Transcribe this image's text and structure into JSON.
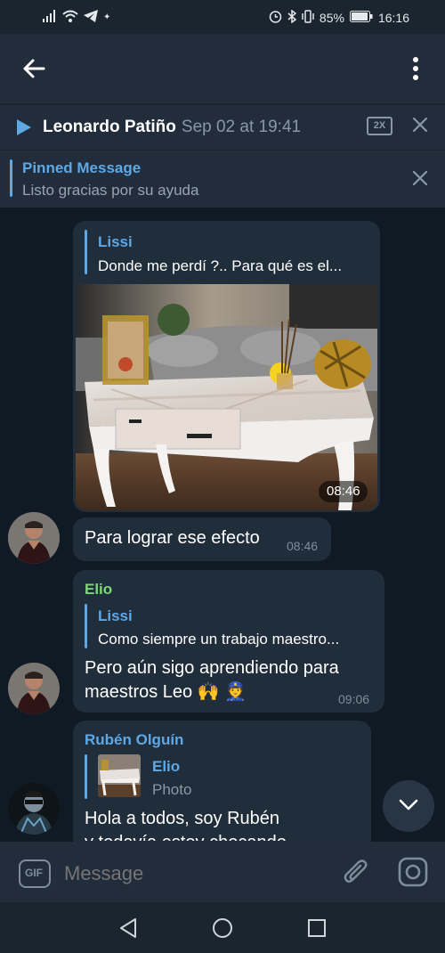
{
  "status_bar": {
    "battery_percent": "85%",
    "time": "16:16"
  },
  "player": {
    "name": "Leonardo Patiño",
    "date": "Sep 02 at 19:41",
    "speed": "2X"
  },
  "pinned": {
    "title": "Pinned Message",
    "text": "Listo gracias por su ayuda"
  },
  "messages": [
    {
      "reply_name": "Lissi",
      "reply_text": "Donde me perdí ?.. Para qué es el...",
      "photo_time": "08:46"
    },
    {
      "text": "Para lograr ese efecto",
      "time": "08:46"
    },
    {
      "sender": "Elio",
      "reply_name": "Lissi",
      "reply_text": "Como siempre un trabajo maestro...",
      "text_line1": "Pero aún sigo aprendiendo para",
      "text_line2": "maestros Leo 🙌 👮",
      "time": "09:06"
    },
    {
      "sender": "Rubén Olguín",
      "reply_name": "Elio",
      "reply_text": "Photo",
      "text_line1": "Hola a todos, soy Rubén",
      "text_line2": "y todavía estoy chocando"
    }
  ],
  "input": {
    "placeholder": "Message",
    "gif_label": "GIF"
  },
  "colors": {
    "accent": "#5fa8e6",
    "elio_name": "#7ed87a",
    "background": "#101a25",
    "bubble": "#202d3a"
  }
}
